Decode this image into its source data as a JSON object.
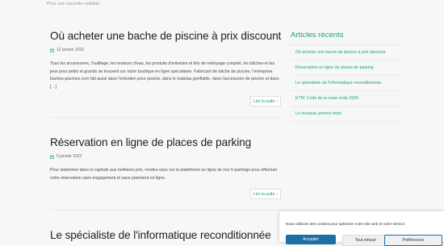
{
  "header": {
    "tagline": "Pour une nouvelle visibilité"
  },
  "posts": [
    {
      "title": "Où acheter une bache de piscine à prix discount",
      "date": "12 janvier 2022",
      "excerpt": "Tous les accessoires, l'outillage, les testeurs d'eau, les produits d'entretien et kits de nettoyage complet, les bâches et les jeux pour petits et grands se trouvent sur notre boutique en ligne spécialisée. Fabricant de bâche de piscine, l'entreprise baches-piscines.com fait aussi dans l'entretien pour piscine, dans le matelas gonflable, dans l'accessoire de piscine et dans […]",
      "readmore": "Lire la suite"
    },
    {
      "title": "Réservation en ligne de places de parking",
      "date": "6 janvier 2022",
      "excerpt": "Pour stationner dans la capitale aux meilleurs prix, rendez-vous sur la plateforme en ligne de nos 5 parkings pour effectuer votre réservation sans engagement et sans paiement en ligne.",
      "readmore": "Lire la suite"
    },
    {
      "title": "Le spécialiste de l'informatique reconditionnée"
    }
  ],
  "sidebar": {
    "title": "Articles récents",
    "items": [
      "Où acheter une bache de piscine à prix discount",
      "Réservation en ligne de places de parking",
      "Le spécialiste de l'informatique reconditionnée",
      "ETM: Code de la route moto 2020",
      "Le nouveau permis moto"
    ]
  },
  "cookie": {
    "text": "Nous utilisons des cookies pour optimiser notre site web et notre service.",
    "accept": "Accepter",
    "deny": "Tout refuser",
    "preferences": "Préférences"
  },
  "colors": {
    "accent": "#17a589",
    "accept_button": "#1f6ea4"
  }
}
